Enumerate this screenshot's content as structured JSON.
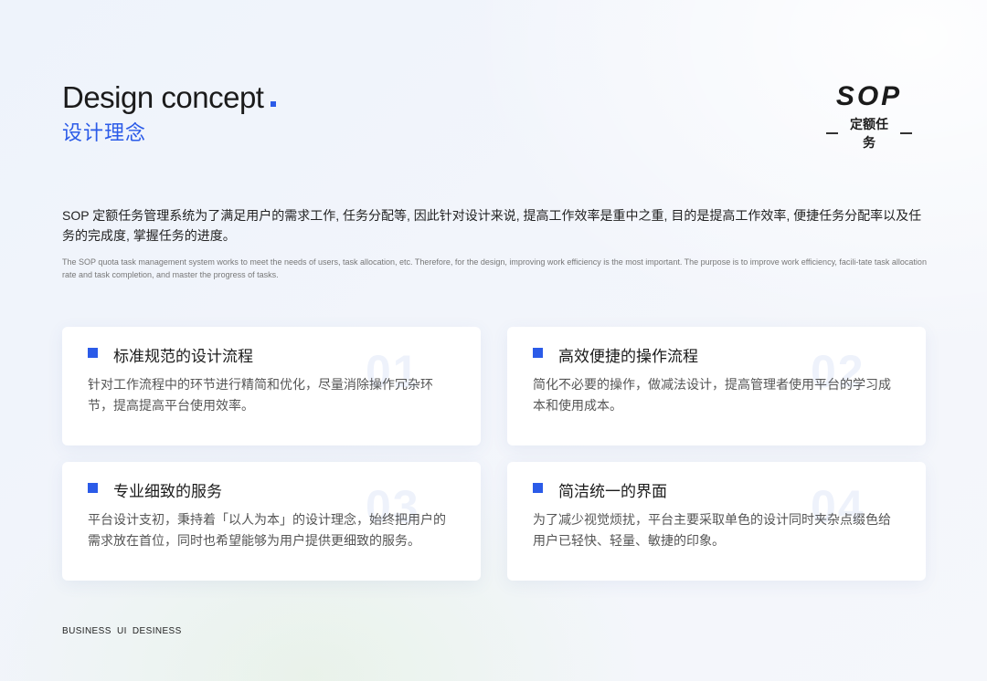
{
  "header": {
    "title_en": "Design concept",
    "title_cn": "设计理念"
  },
  "logo": {
    "main": "SOP",
    "sub": "定额任务"
  },
  "intro": {
    "cn": "SOP 定额任务管理系统为了满足用户的需求工作, 任务分配等, 因此针对设计来说, 提高工作效率是重中之重, 目的是提高工作效率, 便捷任务分配率以及任务的完成度, 掌握任务的进度。",
    "en": "The SOP quota task management system works to meet the needs of users, task allocation, etc. Therefore, for the design, improving work efficiency is the most important. The purpose is to improve work efficiency, facili-tate task allocation rate and task completion, and master the progress of tasks."
  },
  "cards": [
    {
      "num": "01",
      "title": "标准规范的设计流程",
      "desc": "针对工作流程中的环节进行精简和优化，尽量消除操作冗杂环节，提高提高平台使用效率。"
    },
    {
      "num": "02",
      "title": "高效便捷的操作流程",
      "desc": "简化不必要的操作，做减法设计，提高管理者使用平台的学习成本和使用成本。"
    },
    {
      "num": "03",
      "title": "专业细致的服务",
      "desc": "平台设计支初，秉持着「以人为本」的设计理念，始终把用户的需求放在首位，同时也希望能够为用户提供更细致的服务。"
    },
    {
      "num": "04",
      "title": "简洁统一的界面",
      "desc": "为了减少视觉烦扰，平台主要采取单色的设计同时夹杂点缀色给用户已轻快、轻量、敏捷的印象。"
    }
  ],
  "footer": {
    "text": "BUSINESS UI DESINESS"
  },
  "colors": {
    "accent": "#2b5be8",
    "text": "#1b1b1b",
    "muted": "#777777"
  }
}
